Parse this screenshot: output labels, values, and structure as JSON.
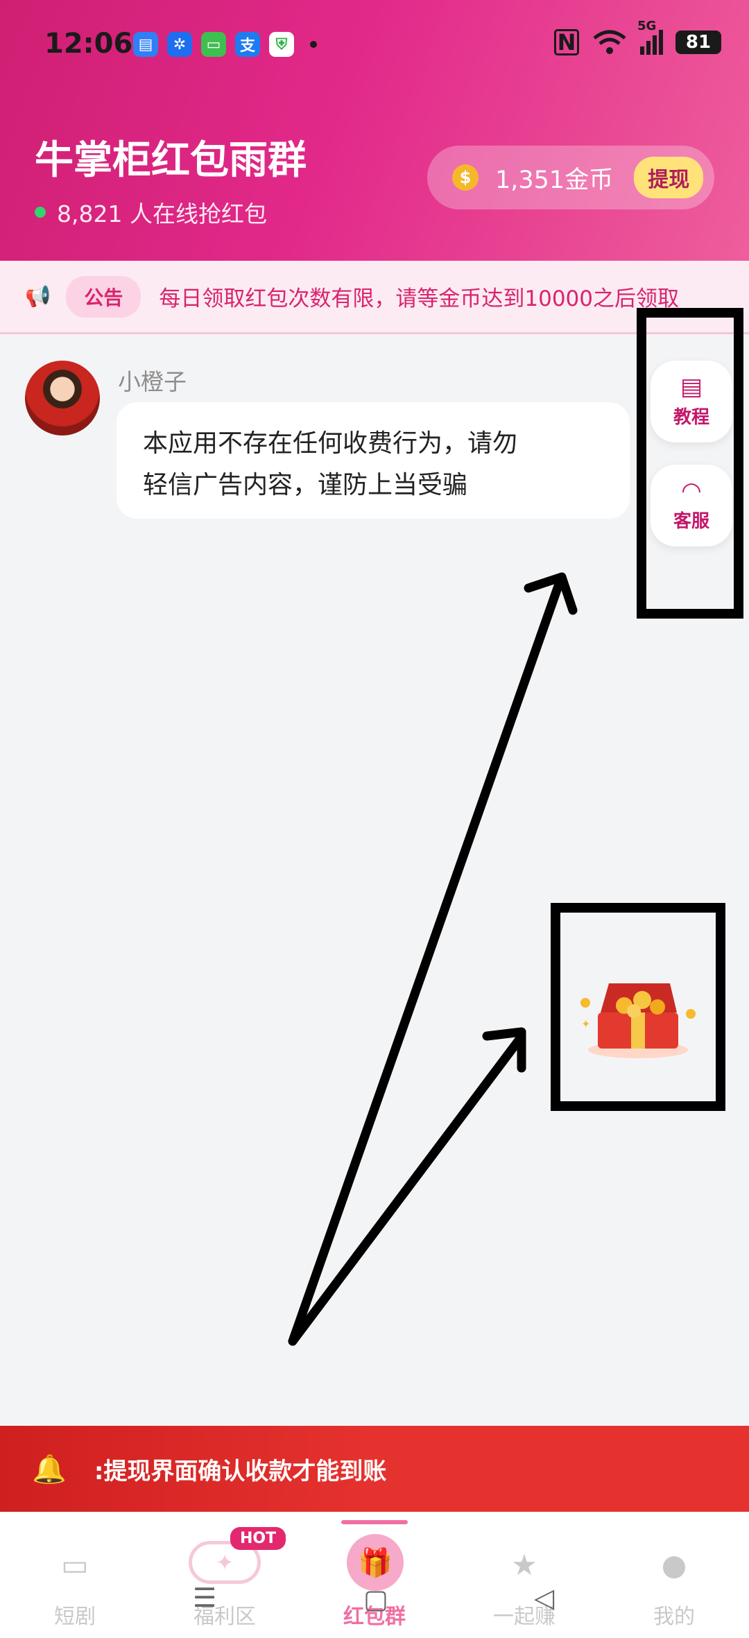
{
  "status_bar": {
    "time": "12:06",
    "battery": "81",
    "network": "5G",
    "nfc": "N",
    "app_icons": [
      {
        "name": "message-app-icon",
        "color": "#2f7ff5",
        "glyph": "▤"
      },
      {
        "name": "fan-app-icon",
        "color": "#1f6ef0",
        "glyph": "✲"
      },
      {
        "name": "chat-app-icon",
        "color": "#3fbf4f",
        "glyph": "▭"
      },
      {
        "name": "alipay-app-icon",
        "color": "#1e7cf0",
        "glyph": "支"
      },
      {
        "name": "shield-app-icon",
        "color": "#ffffff",
        "glyph": "⛨"
      }
    ]
  },
  "header": {
    "title": "牛掌柜红包雨群",
    "online_text": "8,821 人在线抢红包",
    "coin_symbol": "$",
    "coins": "1,351金币",
    "withdraw_label": "提现"
  },
  "notice": {
    "tag": "公告",
    "text": "每日领取红包次数有限，请等金币达到10000之后领取"
  },
  "message": {
    "sender": "小橙子",
    "text_line1": "本应用不存在任何收费行为，请勿",
    "text_line2": "轻信广告内容，谨防上当受骗"
  },
  "side_buttons": {
    "tutorial": "教程",
    "service": "客服"
  },
  "marquee": {
    "text": ":提现界面确认收款才能到账"
  },
  "bottom_nav": {
    "hot_badge": "HOT",
    "tabs": [
      {
        "label": "短剧",
        "icon": "tv-icon"
      },
      {
        "label": "福利区",
        "icon": "sparkle-icon"
      },
      {
        "label": "红包群",
        "icon": "gift-icon"
      },
      {
        "label": "一起赚",
        "icon": "star-icon"
      },
      {
        "label": "我的",
        "icon": "user-icon"
      }
    ]
  },
  "colors": {
    "header_start": "#cf1f73",
    "header_end": "#ee5e9c",
    "accent": "#d8246f",
    "marquee": "#e5322f"
  }
}
